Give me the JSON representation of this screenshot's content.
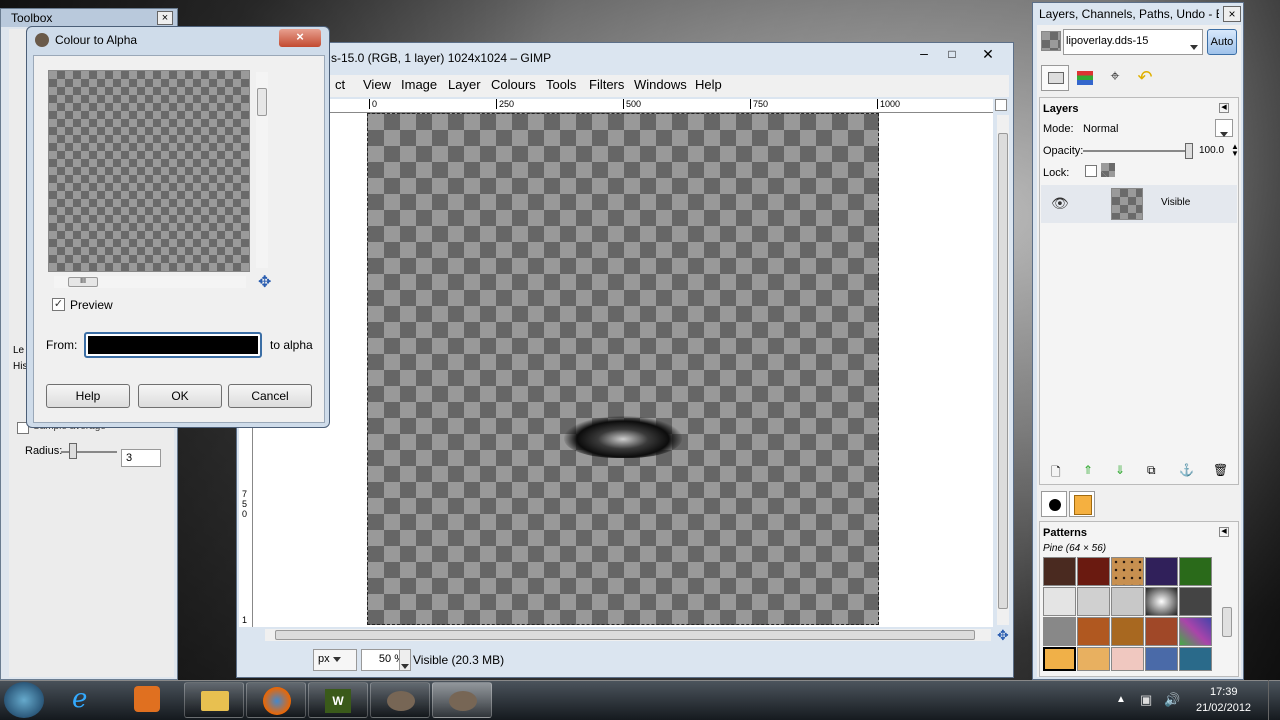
{
  "toolbox": {
    "title": "Toolbox",
    "close": "×",
    "radius_label": "Radius:",
    "radius_value": "3",
    "sample_label": "Sample average",
    "level_label": "Le",
    "history_label": "His"
  },
  "dialog": {
    "title": "Colour to Alpha",
    "close": "×",
    "preview_label": "Preview",
    "from_label": "From:",
    "to_alpha": "to alpha",
    "from_color": "#000000",
    "buttons": {
      "help": "Help",
      "ok": "OK",
      "cancel": "Cancel"
    },
    "hscroll_grip": "III"
  },
  "image_window": {
    "title": "s-15.0 (RGB, 1 layer) 1024x1024 – GIMP",
    "menu": [
      "ct",
      "View",
      "Image",
      "Layer",
      "Colours",
      "Tools",
      "Filters",
      "Windows",
      "Help"
    ],
    "ruler_ticks": [
      "0",
      "250",
      "500",
      "750",
      "1000"
    ],
    "vruler_ticks": [
      "7",
      "5",
      "0",
      "1"
    ],
    "unit": "px",
    "zoom": "50 %",
    "status": "Visible (20.3 MB)"
  },
  "dock": {
    "title": "Layers, Channels, Paths, Undo - B...",
    "close": "×",
    "image_name": "lipoverlay.dds-15",
    "auto": "Auto",
    "layers_label": "Layers",
    "mode_label": "Mode:",
    "mode_value": "Normal",
    "opacity_label": "Opacity:",
    "opacity_value": "100.0",
    "opacity_level": 1.0,
    "lock_label": "Lock:",
    "layer_name": "Visible",
    "patterns_label": "Patterns",
    "pattern_name": "Pine (64 × 56)"
  },
  "taskbar": {
    "time": "17:39",
    "date": "21/02/2012"
  },
  "colors": {
    "accent": "#3b6ea5",
    "fg": "#000000",
    "bg": "#f5b040"
  }
}
